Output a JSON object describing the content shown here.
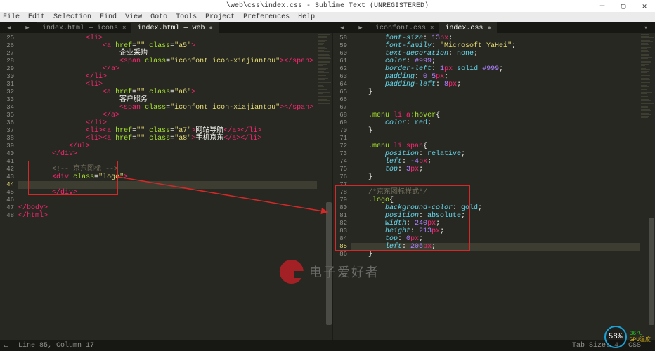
{
  "title": "\\web\\css\\index.css - Sublime Text (UNREGISTERED)",
  "menu": [
    "File",
    "Edit",
    "Selection",
    "Find",
    "View",
    "Goto",
    "Tools",
    "Project",
    "Preferences",
    "Help"
  ],
  "window_controls": {
    "minimize": "—",
    "maximize": "▢",
    "close": "✕"
  },
  "left_tabs": [
    {
      "label": "index.html — icons",
      "active": false
    },
    {
      "label": "index.html — web",
      "active": true
    }
  ],
  "right_tabs": [
    {
      "label": "iconfont.css",
      "active": false
    },
    {
      "label": "index.css",
      "active": true
    }
  ],
  "left_gutter": [
    "25",
    "26",
    "27",
    "28",
    "29",
    "30",
    "31",
    "32",
    "33",
    "34",
    "35",
    "36",
    "37",
    "38",
    "39",
    "40",
    "41",
    "42",
    "43",
    "44",
    "45",
    "46",
    "47",
    "48"
  ],
  "right_gutter": [
    "58",
    "59",
    "60",
    "61",
    "62",
    "63",
    "64",
    "65",
    "66",
    "67",
    "68",
    "69",
    "70",
    "71",
    "72",
    "73",
    "74",
    "75",
    "76",
    "77",
    "78",
    "79",
    "80",
    "81",
    "82",
    "83",
    "84",
    "85",
    "86"
  ],
  "left_code": {
    "25": {
      "indent": 16,
      "tokens": [
        [
          "t-tag",
          "<"
        ],
        [
          "t-name",
          "li"
        ],
        [
          "t-tag",
          ">"
        ]
      ]
    },
    "26": {
      "indent": 20,
      "tokens": [
        [
          "t-tag",
          "<"
        ],
        [
          "t-name",
          "a"
        ],
        [
          "t-text",
          " "
        ],
        [
          "t-attr",
          "href"
        ],
        [
          "t-punc",
          "="
        ],
        [
          "t-str",
          "\"\""
        ],
        [
          "t-text",
          " "
        ],
        [
          "t-attr",
          "class"
        ],
        [
          "t-punc",
          "="
        ],
        [
          "t-str",
          "\"a5\""
        ],
        [
          "t-tag",
          ">"
        ]
      ]
    },
    "27": {
      "indent": 24,
      "tokens": [
        [
          "t-text",
          "企业采购"
        ]
      ]
    },
    "28": {
      "indent": 24,
      "tokens": [
        [
          "t-tag",
          "<"
        ],
        [
          "t-name",
          "span"
        ],
        [
          "t-text",
          " "
        ],
        [
          "t-attr",
          "class"
        ],
        [
          "t-punc",
          "="
        ],
        [
          "t-str",
          "\"iconfont icon-xiajiantou\""
        ],
        [
          "t-tag",
          "></"
        ],
        [
          "t-name",
          "span"
        ],
        [
          "t-tag",
          ">"
        ]
      ]
    },
    "29": {
      "indent": 20,
      "tokens": [
        [
          "t-tag",
          "</"
        ],
        [
          "t-name",
          "a"
        ],
        [
          "t-tag",
          ">"
        ]
      ]
    },
    "30": {
      "indent": 16,
      "tokens": [
        [
          "t-tag",
          "</"
        ],
        [
          "t-name",
          "li"
        ],
        [
          "t-tag",
          ">"
        ]
      ]
    },
    "31": {
      "indent": 16,
      "tokens": [
        [
          "t-tag",
          "<"
        ],
        [
          "t-name",
          "li"
        ],
        [
          "t-tag",
          ">"
        ]
      ]
    },
    "32": {
      "indent": 20,
      "tokens": [
        [
          "t-tag",
          "<"
        ],
        [
          "t-name",
          "a"
        ],
        [
          "t-text",
          " "
        ],
        [
          "t-attr",
          "href"
        ],
        [
          "t-punc",
          "="
        ],
        [
          "t-str",
          "\"\""
        ],
        [
          "t-text",
          " "
        ],
        [
          "t-attr",
          "class"
        ],
        [
          "t-punc",
          "="
        ],
        [
          "t-str",
          "\"a6\""
        ],
        [
          "t-tag",
          ">"
        ]
      ]
    },
    "33": {
      "indent": 24,
      "tokens": [
        [
          "t-text",
          "客户服务"
        ]
      ]
    },
    "34": {
      "indent": 24,
      "tokens": [
        [
          "t-tag",
          "<"
        ],
        [
          "t-name",
          "span"
        ],
        [
          "t-text",
          " "
        ],
        [
          "t-attr",
          "class"
        ],
        [
          "t-punc",
          "="
        ],
        [
          "t-str",
          "\"iconfont icon-xiajiantou\""
        ],
        [
          "t-tag",
          "></"
        ],
        [
          "t-name",
          "span"
        ],
        [
          "t-tag",
          ">"
        ]
      ]
    },
    "35": {
      "indent": 20,
      "tokens": [
        [
          "t-tag",
          "</"
        ],
        [
          "t-name",
          "a"
        ],
        [
          "t-tag",
          ">"
        ]
      ]
    },
    "36": {
      "indent": 16,
      "tokens": [
        [
          "t-tag",
          "</"
        ],
        [
          "t-name",
          "li"
        ],
        [
          "t-tag",
          ">"
        ]
      ]
    },
    "37": {
      "indent": 16,
      "tokens": [
        [
          "t-tag",
          "<"
        ],
        [
          "t-name",
          "li"
        ],
        [
          "t-tag",
          "><"
        ],
        [
          "t-name",
          "a"
        ],
        [
          "t-text",
          " "
        ],
        [
          "t-attr",
          "href"
        ],
        [
          "t-punc",
          "="
        ],
        [
          "t-str",
          "\"\""
        ],
        [
          "t-text",
          " "
        ],
        [
          "t-attr",
          "class"
        ],
        [
          "t-punc",
          "="
        ],
        [
          "t-str",
          "\"a7\""
        ],
        [
          "t-tag",
          ">"
        ],
        [
          "t-text",
          "网站导航"
        ],
        [
          "t-tag",
          "</"
        ],
        [
          "t-name",
          "a"
        ],
        [
          "t-tag",
          "></"
        ],
        [
          "t-name",
          "li"
        ],
        [
          "t-tag",
          ">"
        ]
      ]
    },
    "38": {
      "indent": 16,
      "tokens": [
        [
          "t-tag",
          "<"
        ],
        [
          "t-name",
          "li"
        ],
        [
          "t-tag",
          "><"
        ],
        [
          "t-name",
          "a"
        ],
        [
          "t-text",
          " "
        ],
        [
          "t-attr",
          "href"
        ],
        [
          "t-punc",
          "="
        ],
        [
          "t-str",
          "\"\""
        ],
        [
          "t-text",
          " "
        ],
        [
          "t-attr",
          "class"
        ],
        [
          "t-punc",
          "="
        ],
        [
          "t-str",
          "\"a8\""
        ],
        [
          "t-tag",
          ">"
        ],
        [
          "t-text",
          "手机京东"
        ],
        [
          "t-tag",
          "</"
        ],
        [
          "t-name",
          "a"
        ],
        [
          "t-tag",
          "></"
        ],
        [
          "t-name",
          "li"
        ],
        [
          "t-tag",
          ">"
        ]
      ]
    },
    "39": {
      "indent": 12,
      "tokens": [
        [
          "t-tag",
          "</"
        ],
        [
          "t-name",
          "ul"
        ],
        [
          "t-tag",
          ">"
        ]
      ]
    },
    "40": {
      "indent": 8,
      "tokens": [
        [
          "t-tag",
          "</"
        ],
        [
          "t-name",
          "div"
        ],
        [
          "t-tag",
          ">"
        ]
      ]
    },
    "41": {
      "indent": 0,
      "tokens": []
    },
    "42": {
      "indent": 8,
      "tokens": [
        [
          "t-comment",
          "<!-- 京东图标 -->"
        ]
      ]
    },
    "43": {
      "indent": 8,
      "tokens": [
        [
          "t-tag",
          "<"
        ],
        [
          "t-name",
          "div"
        ],
        [
          "t-text",
          " "
        ],
        [
          "t-attr",
          "class"
        ],
        [
          "t-punc",
          "="
        ],
        [
          "t-str",
          "\"logo\""
        ],
        [
          "t-tag",
          ">"
        ]
      ]
    },
    "44": {
      "indent": 0,
      "tokens": []
    },
    "45": {
      "indent": 8,
      "tokens": [
        [
          "t-tag",
          "</"
        ],
        [
          "t-name",
          "div"
        ],
        [
          "t-tag",
          ">"
        ]
      ]
    },
    "46": {
      "indent": 0,
      "tokens": []
    },
    "47": {
      "indent": 0,
      "tokens": [
        [
          "t-tag",
          "</"
        ],
        [
          "t-name",
          "body"
        ],
        [
          "t-tag",
          ">"
        ]
      ]
    },
    "48": {
      "indent": 0,
      "tokens": [
        [
          "t-tag",
          "</"
        ],
        [
          "t-name",
          "html"
        ],
        [
          "t-tag",
          ">"
        ]
      ]
    }
  },
  "right_code": {
    "58": {
      "indent": 8,
      "tokens": [
        [
          "t-prop",
          "font-size"
        ],
        [
          "t-punc",
          ": "
        ],
        [
          "t-num",
          "13"
        ],
        [
          "t-unit",
          "px"
        ],
        [
          "t-punc",
          ";"
        ]
      ]
    },
    "59": {
      "indent": 8,
      "tokens": [
        [
          "t-prop",
          "font-family"
        ],
        [
          "t-punc",
          ": "
        ],
        [
          "t-str",
          "\"Microsoft YaHei\""
        ],
        [
          "t-punc",
          ";"
        ]
      ]
    },
    "60": {
      "indent": 8,
      "tokens": [
        [
          "t-prop",
          "text-decoration"
        ],
        [
          "t-punc",
          ": "
        ],
        [
          "t-kw",
          "none"
        ],
        [
          "t-punc",
          ";"
        ]
      ]
    },
    "61": {
      "indent": 8,
      "tokens": [
        [
          "t-prop",
          "color"
        ],
        [
          "t-punc",
          ": "
        ],
        [
          "t-col",
          "#999"
        ],
        [
          "t-punc",
          ";"
        ]
      ]
    },
    "62": {
      "indent": 8,
      "tokens": [
        [
          "t-prop",
          "border-left"
        ],
        [
          "t-punc",
          ": "
        ],
        [
          "t-num",
          "1"
        ],
        [
          "t-unit",
          "px"
        ],
        [
          "t-text",
          " "
        ],
        [
          "t-kw",
          "solid"
        ],
        [
          "t-text",
          " "
        ],
        [
          "t-col",
          "#999"
        ],
        [
          "t-punc",
          ";"
        ]
      ]
    },
    "63": {
      "indent": 8,
      "tokens": [
        [
          "t-prop",
          "padding"
        ],
        [
          "t-punc",
          ": "
        ],
        [
          "t-num",
          "0"
        ],
        [
          "t-text",
          " "
        ],
        [
          "t-num",
          "5"
        ],
        [
          "t-unit",
          "px"
        ],
        [
          "t-punc",
          ";"
        ]
      ]
    },
    "64": {
      "indent": 8,
      "tokens": [
        [
          "t-prop",
          "padding-left"
        ],
        [
          "t-punc",
          ": "
        ],
        [
          "t-num",
          "8"
        ],
        [
          "t-unit",
          "px"
        ],
        [
          "t-punc",
          ";"
        ]
      ]
    },
    "65": {
      "indent": 4,
      "tokens": [
        [
          "t-punc",
          "}"
        ]
      ]
    },
    "66": {
      "indent": 0,
      "tokens": []
    },
    "67": {
      "indent": 0,
      "tokens": []
    },
    "68": {
      "indent": 4,
      "tokens": [
        [
          "t-sel",
          ".menu "
        ],
        [
          "t-name",
          "li "
        ],
        [
          "t-name",
          "a"
        ],
        [
          "t-ps",
          ":hover"
        ],
        [
          "t-punc",
          "{"
        ]
      ]
    },
    "69": {
      "indent": 8,
      "tokens": [
        [
          "t-prop",
          "color"
        ],
        [
          "t-punc",
          ": "
        ],
        [
          "t-kw",
          "red"
        ],
        [
          "t-punc",
          ";"
        ]
      ]
    },
    "70": {
      "indent": 4,
      "tokens": [
        [
          "t-punc",
          "}"
        ]
      ]
    },
    "71": {
      "indent": 0,
      "tokens": []
    },
    "72": {
      "indent": 4,
      "tokens": [
        [
          "t-sel",
          ".menu "
        ],
        [
          "t-name",
          "li "
        ],
        [
          "t-name",
          "span"
        ],
        [
          "t-punc",
          "{"
        ]
      ]
    },
    "73": {
      "indent": 8,
      "tokens": [
        [
          "t-prop",
          "position"
        ],
        [
          "t-punc",
          ": "
        ],
        [
          "t-kw",
          "relative"
        ],
        [
          "t-punc",
          ";"
        ]
      ]
    },
    "74": {
      "indent": 8,
      "tokens": [
        [
          "t-prop",
          "left"
        ],
        [
          "t-punc",
          ": "
        ],
        [
          "t-num",
          "-4"
        ],
        [
          "t-unit",
          "px"
        ],
        [
          "t-punc",
          ";"
        ]
      ]
    },
    "75": {
      "indent": 8,
      "tokens": [
        [
          "t-prop",
          "top"
        ],
        [
          "t-punc",
          ": "
        ],
        [
          "t-num",
          "3"
        ],
        [
          "t-unit",
          "px"
        ],
        [
          "t-punc",
          ";"
        ]
      ]
    },
    "76": {
      "indent": 4,
      "tokens": [
        [
          "t-punc",
          "}"
        ]
      ]
    },
    "77": {
      "indent": 0,
      "tokens": []
    },
    "78": {
      "indent": 4,
      "tokens": [
        [
          "t-comment",
          "/*京东图标样式*/"
        ]
      ]
    },
    "79": {
      "indent": 4,
      "tokens": [
        [
          "t-sel",
          ".logo"
        ],
        [
          "t-punc",
          "{"
        ]
      ]
    },
    "80": {
      "indent": 8,
      "tokens": [
        [
          "t-prop",
          "background-color"
        ],
        [
          "t-punc",
          ": "
        ],
        [
          "t-kw",
          "gold"
        ],
        [
          "t-punc",
          ";"
        ]
      ]
    },
    "81": {
      "indent": 8,
      "tokens": [
        [
          "t-prop",
          "position"
        ],
        [
          "t-punc",
          ": "
        ],
        [
          "t-kw",
          "absolute"
        ],
        [
          "t-punc",
          ";"
        ]
      ]
    },
    "82": {
      "indent": 8,
      "tokens": [
        [
          "t-prop",
          "width"
        ],
        [
          "t-punc",
          ": "
        ],
        [
          "t-num",
          "240"
        ],
        [
          "t-unit",
          "px"
        ],
        [
          "t-punc",
          ";"
        ]
      ]
    },
    "83": {
      "indent": 8,
      "tokens": [
        [
          "t-prop",
          "height"
        ],
        [
          "t-punc",
          ": "
        ],
        [
          "t-num",
          "213"
        ],
        [
          "t-unit",
          "px"
        ],
        [
          "t-punc",
          ";"
        ]
      ]
    },
    "84": {
      "indent": 8,
      "tokens": [
        [
          "t-prop",
          "top"
        ],
        [
          "t-punc",
          ": "
        ],
        [
          "t-num",
          "0"
        ],
        [
          "t-unit",
          "px"
        ],
        [
          "t-punc",
          ";"
        ]
      ]
    },
    "85": {
      "indent": 8,
      "tokens": [
        [
          "t-prop",
          "left"
        ],
        [
          "t-punc",
          ": "
        ],
        [
          "t-num",
          "205"
        ],
        [
          "t-unit",
          "px"
        ],
        [
          "t-punc",
          ";"
        ]
      ]
    },
    "86": {
      "indent": 4,
      "tokens": [
        [
          "t-punc",
          "}"
        ]
      ]
    }
  },
  "status": {
    "left": "Line 85, Column 17",
    "right1": "Tab Size: 4",
    "right2": "CSS"
  },
  "watermark": "电子爱好者",
  "hud": {
    "percent": "58%",
    "cpu_temp": "36℃",
    "gpu_temp_label": "GPU温度"
  },
  "left_current_line": "44",
  "right_current_line": "85"
}
